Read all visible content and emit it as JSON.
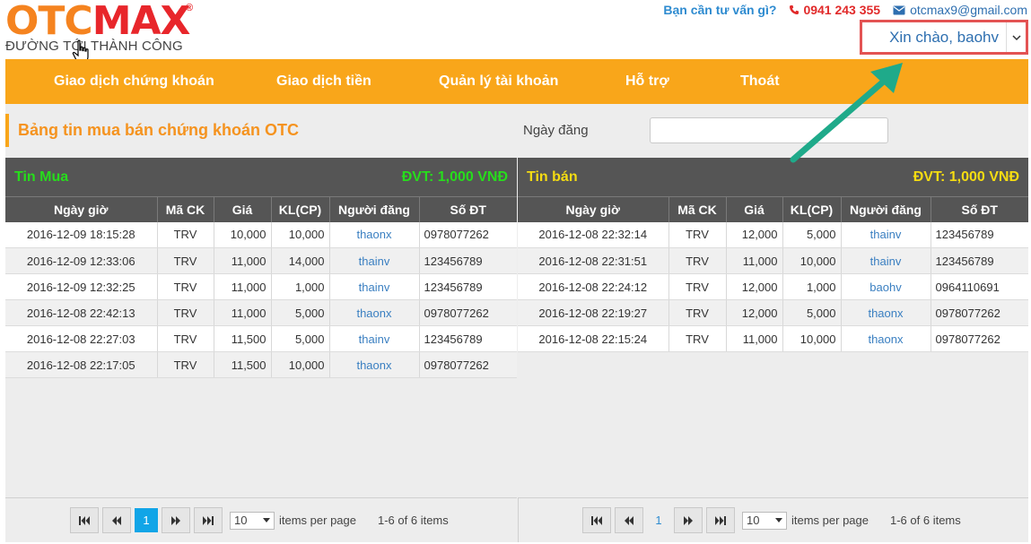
{
  "header": {
    "logo_otc": "OTC",
    "logo_max": "MAX",
    "logo_reg": "®",
    "tagline": "ĐƯỜNG TỚI THÀNH CÔNG",
    "advise_text": "Bạn cần tư vấn gì?",
    "phone": "0941 243 355",
    "email": "otcmax9@gmail.com",
    "greeting": "Xin chào, baohv"
  },
  "nav": {
    "items": [
      "Giao dịch chứng khoán",
      "Giao dịch tiền",
      "Quản lý tài khoản",
      "Hỗ trợ",
      "Thoát"
    ]
  },
  "board": {
    "title": "Bảng tin mua bán chứng khoán OTC",
    "date_label": "Ngày đăng",
    "date_value": ""
  },
  "columns": [
    "Ngày giờ",
    "Mã CK",
    "Giá",
    "KL(CP)",
    "Người đăng",
    "Số ĐT"
  ],
  "buy": {
    "title": "Tin Mua",
    "unit": "ĐVT: 1,000 VNĐ",
    "rows": [
      [
        "2016-12-09 18:15:28",
        "TRV",
        "10,000",
        "10,000",
        "thaonx",
        "0978077262"
      ],
      [
        "2016-12-09 12:33:06",
        "TRV",
        "11,000",
        "14,000",
        "thainv",
        "123456789"
      ],
      [
        "2016-12-09 12:32:25",
        "TRV",
        "11,000",
        "1,000",
        "thainv",
        "123456789"
      ],
      [
        "2016-12-08 22:42:13",
        "TRV",
        "11,000",
        "5,000",
        "thaonx",
        "0978077262"
      ],
      [
        "2016-12-08 22:27:03",
        "TRV",
        "11,500",
        "5,000",
        "thainv",
        "123456789"
      ],
      [
        "2016-12-08 22:17:05",
        "TRV",
        "11,500",
        "10,000",
        "thaonx",
        "0978077262"
      ]
    ],
    "pager": {
      "page": "1",
      "page_size": "10",
      "per_page_label": "items per page",
      "summary": "1-6 of 6 items"
    }
  },
  "sell": {
    "title": "Tin bán",
    "unit": "ĐVT: 1,000 VNĐ",
    "rows": [
      [
        "2016-12-08 22:32:14",
        "TRV",
        "12,000",
        "5,000",
        "thainv",
        "123456789"
      ],
      [
        "2016-12-08 22:31:51",
        "TRV",
        "11,000",
        "10,000",
        "thainv",
        "123456789"
      ],
      [
        "2016-12-08 22:24:12",
        "TRV",
        "12,000",
        "1,000",
        "baohv",
        "0964110691"
      ],
      [
        "2016-12-08 22:19:27",
        "TRV",
        "12,000",
        "5,000",
        "thaonx",
        "0978077262"
      ],
      [
        "2016-12-08 22:15:24",
        "TRV",
        "11,000",
        "10,000",
        "thaonx",
        "0978077262"
      ]
    ],
    "pager": {
      "page": "1",
      "page_size": "10",
      "per_page_label": "items per page",
      "summary": "1-6 of 6 items"
    }
  },
  "colors": {
    "nav_bg": "#f9a61a",
    "buy_accent": "#27dd1c",
    "sell_accent": "#f5dc12",
    "highlight_box": "#e35353",
    "annotation_arrow": "#1faa8a",
    "active_page": "#11a5e7"
  },
  "icons": {
    "phone": "phone-icon",
    "email": "envelope-icon",
    "dropdown": "chevron-down-icon",
    "pager_first": "first-page-icon",
    "pager_prev": "prev-page-icon",
    "pager_next": "next-page-icon",
    "pager_last": "last-page-icon"
  }
}
